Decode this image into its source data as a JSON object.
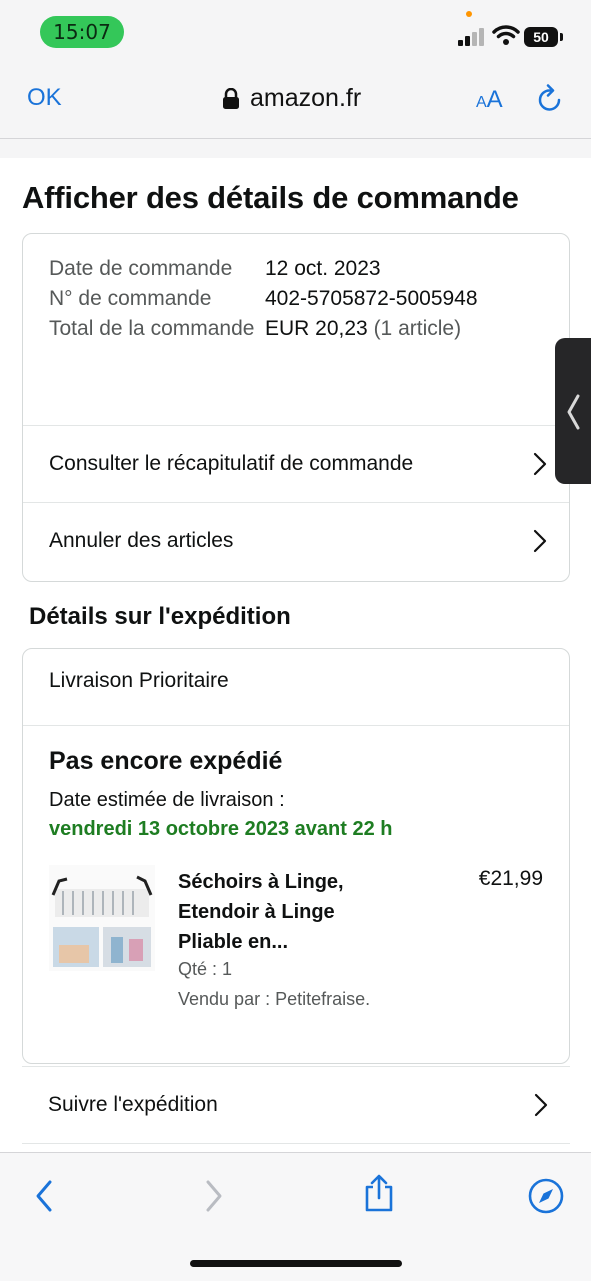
{
  "status_bar": {
    "time": "15:07",
    "battery": "50"
  },
  "browser": {
    "done_label": "OK",
    "url": "amazon.fr",
    "text_size_label_small": "A",
    "text_size_label_large": "A"
  },
  "page": {
    "title": "Afficher des détails de commande",
    "order_info": [
      {
        "label": "Date de commande",
        "value": "12 oct. 2023",
        "extra": ""
      },
      {
        "label": "N° de commande",
        "value": "402-5705872-5005948",
        "extra": ""
      },
      {
        "label": "Total de la commande",
        "value": "EUR 20,23",
        "extra": " (1 article)"
      }
    ],
    "links": {
      "summary": "Consulter le récapitulatif de commande",
      "cancel": "Annuler des articles"
    },
    "shipping_section_title": "Détails sur l'expédition",
    "shipment": {
      "delivery_type": "Livraison Prioritaire",
      "status": "Pas encore expédié",
      "eta_label": "Date estimée de livraison :",
      "eta_date": "vendredi 13 octobre 2023 avant 22 h",
      "product_name": "Séchoirs à Linge, Etendoir à Linge Pliable en...",
      "price": "€21,99",
      "quantity": "Qté : 1",
      "seller": "Vendu par : Petitefraise."
    },
    "track_label": "Suivre l'expédition"
  },
  "colors": {
    "accent": "#1a73d9",
    "eta_green": "#1e7d22",
    "status_green": "#34c759"
  },
  "toolbar_icons": [
    "back-icon",
    "forward-icon",
    "share-icon",
    "compass-icon"
  ]
}
